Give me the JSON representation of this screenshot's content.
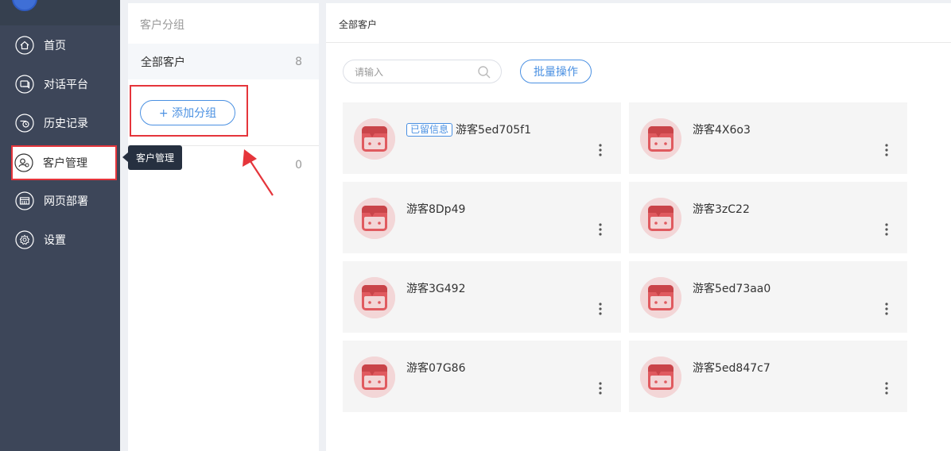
{
  "sidebar": {
    "items": [
      {
        "label": "首页",
        "icon": "home-icon"
      },
      {
        "label": "对话平台",
        "icon": "chat-icon"
      },
      {
        "label": "历史记录",
        "icon": "history-icon"
      },
      {
        "label": "客户管理",
        "icon": "customer-icon",
        "active": true
      },
      {
        "label": "网页部署",
        "icon": "web-deploy-icon"
      },
      {
        "label": "设置",
        "icon": "settings-icon"
      }
    ],
    "tooltip": "客户管理"
  },
  "groups": {
    "title": "客户分组",
    "items": [
      {
        "label": "全部客户",
        "count": "8"
      },
      {
        "label": "",
        "count": "0"
      }
    ],
    "add_label": "+ 添加分组"
  },
  "main": {
    "title": "全部客户",
    "search_placeholder": "请输入",
    "batch_label": "批量操作",
    "customers": [
      {
        "tag": "已留信息",
        "name": "游客5ed705f1"
      },
      {
        "tag": "",
        "name": "游客4X6o3"
      },
      {
        "tag": "",
        "name": "游客8Dp49"
      },
      {
        "tag": "",
        "name": "游客3zC22"
      },
      {
        "tag": "",
        "name": "游客3G492"
      },
      {
        "tag": "",
        "name": "游客5ed73aa0"
      },
      {
        "tag": "",
        "name": "游客07G86"
      },
      {
        "tag": "",
        "name": "游客5ed847c7"
      }
    ]
  },
  "colors": {
    "sidebar_bg": "#3d4659",
    "accent": "#4a90e2",
    "highlight": "#e5353b",
    "avatar": "#e05a5f"
  }
}
